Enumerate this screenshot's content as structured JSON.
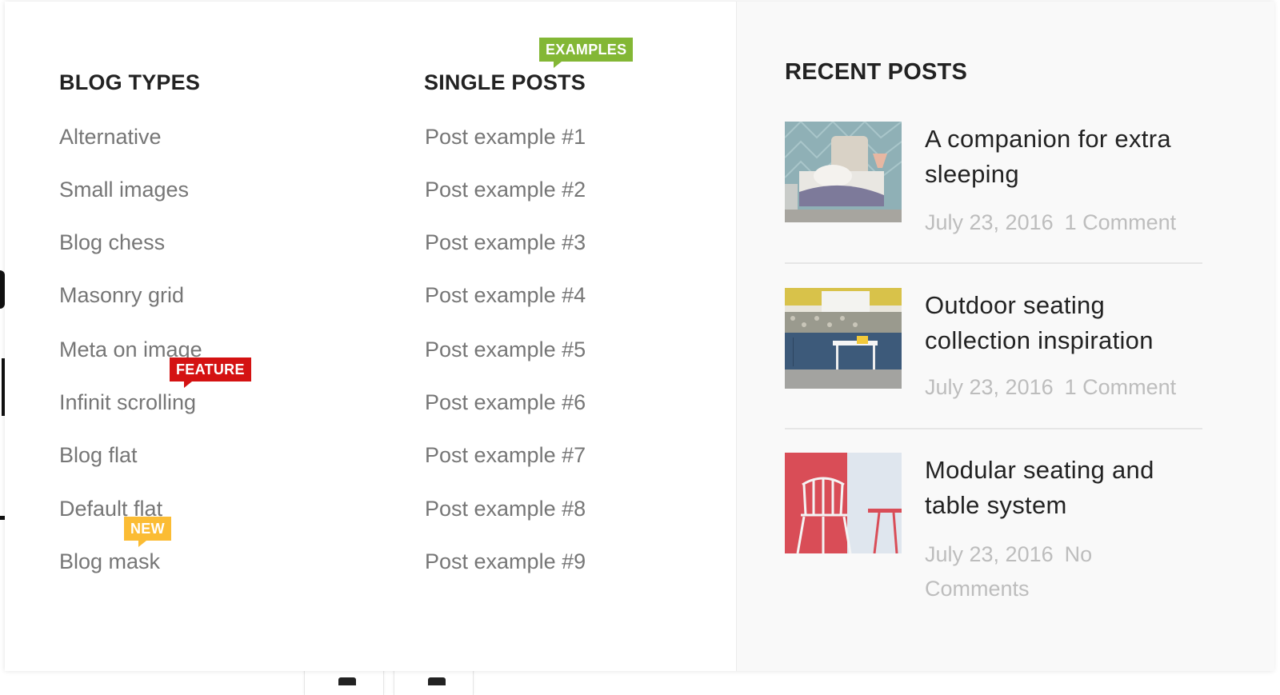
{
  "blog_types": {
    "title": "BLOG TYPES",
    "items": [
      {
        "label": "Alternative"
      },
      {
        "label": "Small images"
      },
      {
        "label": "Blog chess"
      },
      {
        "label": "Masonry grid"
      },
      {
        "label": "Meta on image"
      },
      {
        "label": "Infinit scrolling",
        "badge": "FEATURE"
      },
      {
        "label": "Blog flat"
      },
      {
        "label": "Default flat"
      },
      {
        "label": "Blog mask",
        "badge": "NEW"
      }
    ]
  },
  "single_posts": {
    "title": "SINGLE POSTS",
    "badge": "EXAMPLES",
    "items": [
      "Post example #1",
      "Post example #2",
      "Post example #3",
      "Post example #4",
      "Post example #5",
      "Post example #6",
      "Post example #7",
      "Post example #8",
      "Post example #9"
    ]
  },
  "recent_posts": {
    "title": "RECENT POSTS",
    "posts": [
      {
        "title": "A companion for extra sleeping",
        "date": "July 23, 2016",
        "comments": "1 Comment"
      },
      {
        "title": "Outdoor seating collection inspiration",
        "date": "July 23, 2016",
        "comments": "1 Comment"
      },
      {
        "title": "Modular seating and table system",
        "date": "July 23, 2016",
        "comments": "No Comments"
      }
    ]
  },
  "colors": {
    "badge_examples": "#83b735",
    "badge_feature": "#d41212",
    "badge_new": "#fbbc34"
  }
}
